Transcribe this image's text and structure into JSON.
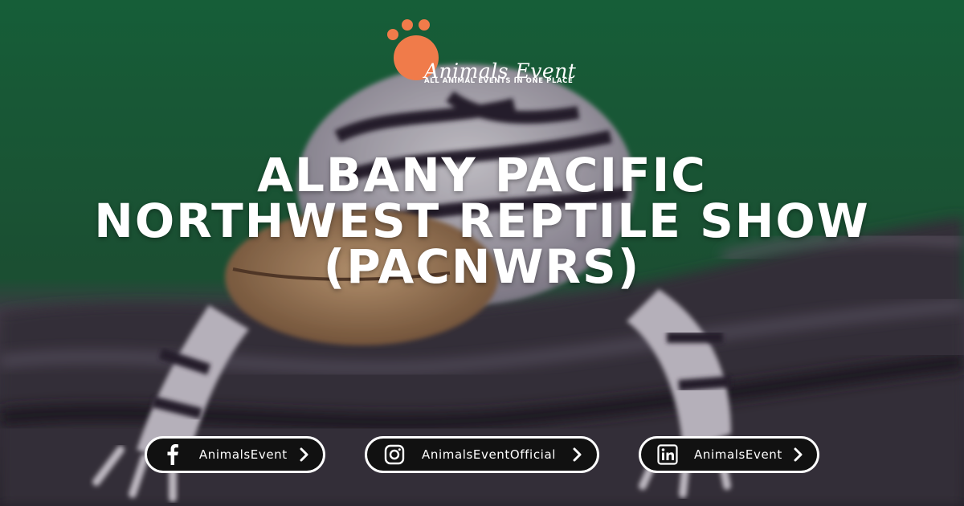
{
  "logo": {
    "name": "Animals Event",
    "tagline": "ALL ANIMAL EVENTS IN ONE PLACE",
    "paw_color": "#f07b4a"
  },
  "headline": {
    "line1": "ALBANY PACIFIC",
    "line2": "NORTHWEST REPTILE SHOW",
    "line3": "(PACNWRS)"
  },
  "social": [
    {
      "platform": "facebook",
      "icon": "facebook-icon",
      "handle": "AnimalsEvent"
    },
    {
      "platform": "instagram",
      "icon": "instagram-icon",
      "handle": "AnimalsEventOfficial"
    },
    {
      "platform": "linkedin",
      "icon": "linkedin-icon",
      "handle": "AnimalsEvent"
    }
  ],
  "background": {
    "subject": "salamander-photo",
    "top_color": "#1e6a40",
    "bottom_color": "#3a3340"
  }
}
